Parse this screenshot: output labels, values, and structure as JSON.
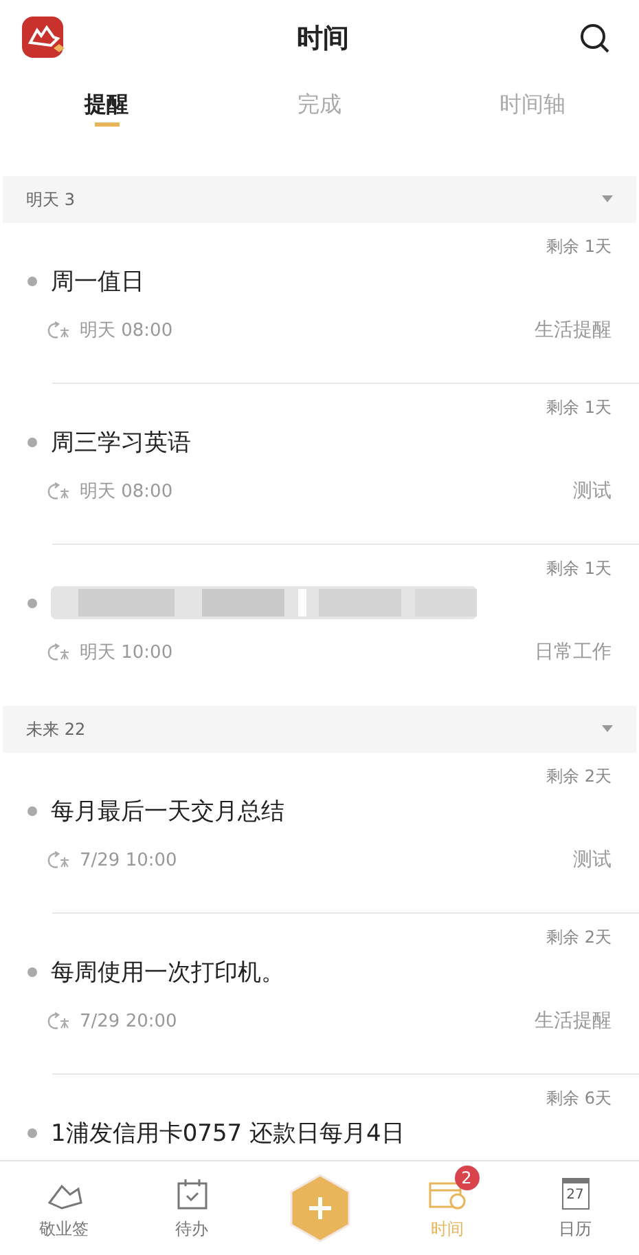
{
  "header": {
    "title": "时间"
  },
  "tabs": [
    {
      "label": "提醒",
      "selected": true
    },
    {
      "label": "完成",
      "selected": false
    },
    {
      "label": "时间轴",
      "selected": false
    }
  ],
  "groups": [
    {
      "label": "明天 3",
      "items": [
        {
          "remaining": "剩余 1天",
          "title": "周一值日",
          "time": "明天 08:00",
          "category": "生活提醒"
        },
        {
          "remaining": "剩余 1天",
          "title": "周三学习英语",
          "time": "明天 08:00",
          "category": "测试"
        },
        {
          "remaining": "剩余 1天",
          "kind": "blurred",
          "time": "明天 10:00",
          "category": "日常工作"
        }
      ]
    },
    {
      "label": "未来 22",
      "items": [
        {
          "remaining": "剩余 2天",
          "title": "每月最后一天交月总结",
          "time": "7/29 10:00",
          "category": "测试"
        },
        {
          "remaining": "剩余 2天",
          "title": "每周使用一次打印机。",
          "time": "7/29 20:00",
          "category": "生活提醒"
        },
        {
          "remaining": "剩余 6天",
          "title": "1浦发信用卡0757 还款日每月4日"
        }
      ]
    }
  ],
  "nav": [
    {
      "kind": "notes",
      "label": "敬业签",
      "selected": false
    },
    {
      "kind": "todo",
      "label": "待办",
      "selected": false
    },
    {
      "kind": "add"
    },
    {
      "kind": "time",
      "label": "时间",
      "selected": true,
      "badge": "2"
    },
    {
      "kind": "calendar",
      "label": "日历",
      "selected": false,
      "day": "27"
    }
  ]
}
